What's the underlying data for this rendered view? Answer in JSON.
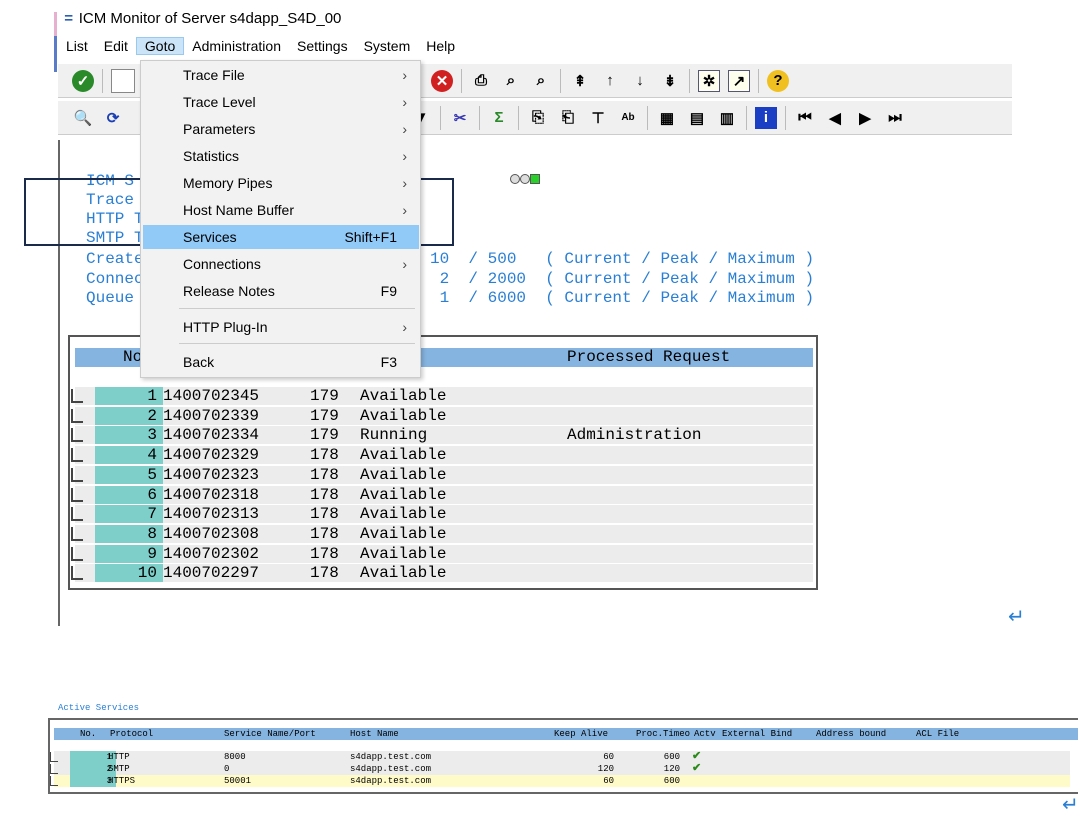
{
  "window": {
    "title": "ICM Monitor of Server s4dapp_S4D_00"
  },
  "menubar": [
    "List",
    "Edit",
    "Goto",
    "Administration",
    "Settings",
    "System",
    "Help"
  ],
  "goto_menu": [
    {
      "label": "Trace File",
      "submenu": true
    },
    {
      "label": "Trace Level",
      "submenu": true
    },
    {
      "label": "Parameters",
      "submenu": true
    },
    {
      "label": "Statistics",
      "submenu": true
    },
    {
      "label": "Memory Pipes",
      "submenu": true
    },
    {
      "label": "Host Name Buffer",
      "submenu": true
    },
    {
      "label": "Services",
      "shortcut": "Shift+F1",
      "selected": true
    },
    {
      "label": "Connections",
      "submenu": true
    },
    {
      "label": "Release Notes",
      "shortcut": "F9"
    },
    {
      "label": "HTTP Plug-In",
      "submenu": true
    },
    {
      "label": "Back",
      "shortcut": "F3"
    }
  ],
  "info": {
    "lines": [
      "ICM S",
      "Trace",
      "HTTP T",
      "SMTP T",
      "Create",
      "Connec",
      "Queue"
    ],
    "stats": [
      "10  / 500   ( Current / Peak / Maximum )",
      " 2  / 2000  ( Current / Peak / Maximum )",
      " 1  / 6000  ( Current / Peak / Maximum )"
    ],
    "status_light": "green"
  },
  "threads": {
    "headers": {
      "no": "No",
      "processed": "Processed Request"
    },
    "rows": [
      [
        "1",
        "1400702345",
        "179",
        "Available",
        ""
      ],
      [
        "2",
        "1400702339",
        "179",
        "Available",
        ""
      ],
      [
        "3",
        "1400702334",
        "179",
        "Running",
        "Administration"
      ],
      [
        "4",
        "1400702329",
        "178",
        "Available",
        ""
      ],
      [
        "5",
        "1400702323",
        "178",
        "Available",
        ""
      ],
      [
        "6",
        "1400702318",
        "178",
        "Available",
        ""
      ],
      [
        "7",
        "1400702313",
        "178",
        "Available",
        ""
      ],
      [
        "8",
        "1400702308",
        "178",
        "Available",
        ""
      ],
      [
        "9",
        "1400702302",
        "178",
        "Available",
        ""
      ],
      [
        "10",
        "1400702297",
        "178",
        "Available",
        ""
      ]
    ]
  },
  "services": {
    "title": "Active Services",
    "headers": [
      "No.",
      "Protocol",
      "Service Name/Port",
      "Host Name",
      "Keep Alive",
      "Proc.Timeo",
      "Actv",
      "External Bind",
      "Address bound",
      "ACL File"
    ],
    "rows": [
      {
        "no": "1",
        "protocol": "HTTP",
        "port": "8000",
        "host": "s4dapp.test.com",
        "keep": "60",
        "timeo": "600",
        "active": true
      },
      {
        "no": "2",
        "protocol": "SMTP",
        "port": "0",
        "host": "s4dapp.test.com",
        "keep": "120",
        "timeo": "120",
        "active": true
      },
      {
        "no": "3",
        "protocol": "HTTPS",
        "port": "50001",
        "host": "s4dapp.test.com",
        "keep": "60",
        "timeo": "600",
        "active": false,
        "highlighted": true
      }
    ]
  },
  "colors": {
    "accent_blue": "#2a7fd4",
    "header_blue": "#86b4e0",
    "teal": "#7ecfca",
    "selected": "#91c9f7",
    "highlight_yellow": "#fffbc8"
  }
}
